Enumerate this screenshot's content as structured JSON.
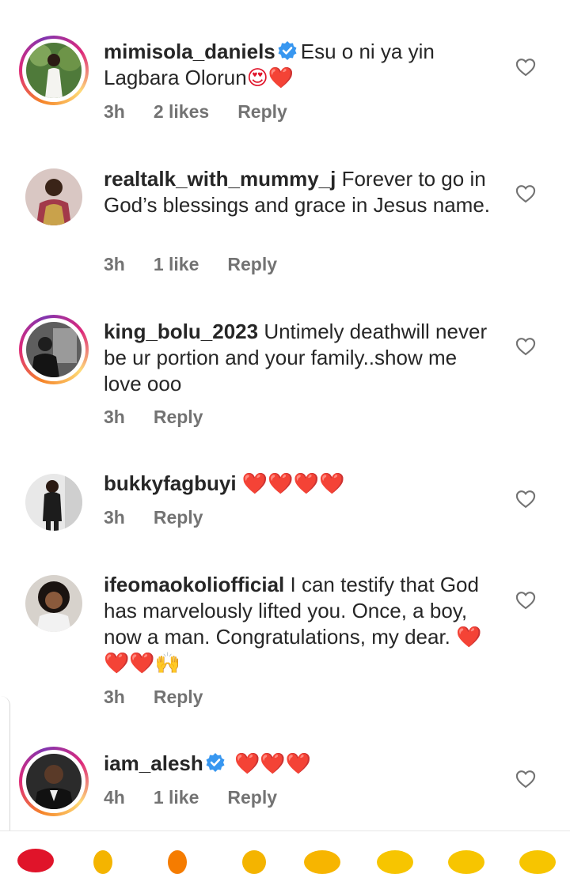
{
  "comments": [
    {
      "username": "mimisola_daniels",
      "verified": true,
      "story_ring": true,
      "text": "Esu o ni ya yin Lagbara Olorun",
      "emoji_suffix": "😍❤️",
      "time": "3h",
      "likes": "2 likes",
      "reply": "Reply"
    },
    {
      "username": "realtalk_with_mummy_j",
      "verified": false,
      "story_ring": false,
      "text": "Forever to go in God’s blessings and grace in Jesus name.",
      "time": "3h",
      "likes": "1 like",
      "reply": "Reply"
    },
    {
      "username": "king_bolu_2023",
      "verified": false,
      "story_ring": true,
      "text": "Untimely deathwill never be ur portion and your family..show me love ooo",
      "time": "3h",
      "reply": "Reply"
    },
    {
      "username": "bukkyfagbuyi",
      "verified": false,
      "story_ring": false,
      "text": "❤️❤️❤️❤️",
      "time": "3h",
      "reply": "Reply"
    },
    {
      "username": "ifeomaokoliofficial",
      "verified": false,
      "story_ring": false,
      "text": "I can testify that God has marvelously lifted you. Once, a boy,  now a man. Congratulations, my dear.",
      "emoji_suffix": "❤️❤️❤️🙌",
      "time": "3h",
      "reply": "Reply"
    },
    {
      "username": "iam_alesh",
      "verified": true,
      "story_ring": true,
      "text": "❤️❤️❤️",
      "time": "4h",
      "likes": "1 like",
      "reply": "Reply"
    }
  ],
  "colors": {
    "text": "#262626",
    "meta": "#737373",
    "verified_blue": "#3897f0",
    "heart_red": "#e0142a"
  },
  "icons": {
    "like": "heart-outline-icon",
    "verified": "verified-badge-icon"
  }
}
